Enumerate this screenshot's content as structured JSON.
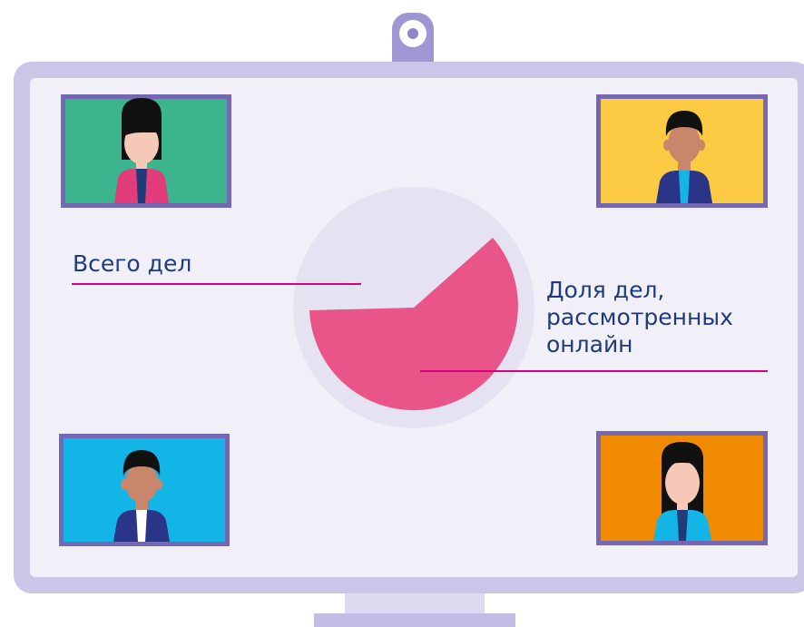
{
  "labels": {
    "total": "Всего дел",
    "online_line1": "Доля дел,",
    "online_line2": "рассмотренных",
    "online_line3": "онлайн"
  },
  "colors": {
    "monitor_frame": "#cbc6e8",
    "screen": "#f1f0f8",
    "pie_total": "#e5e3f2",
    "pie_online": "#ea5589",
    "leader_line": "#d9007e",
    "text": "#1f3b7a",
    "tile_border": "#7467b3",
    "tile_green": "#3cb48e",
    "tile_yellow": "#fdca43",
    "tile_blue": "#13b4e6",
    "tile_orange": "#f08a00"
  },
  "chart_data": {
    "type": "pie",
    "slices": [
      {
        "label": "Всего дел",
        "value": 0.38
      },
      {
        "label": "Доля дел, рассмотренных онлайн",
        "value": 0.62
      }
    ]
  }
}
